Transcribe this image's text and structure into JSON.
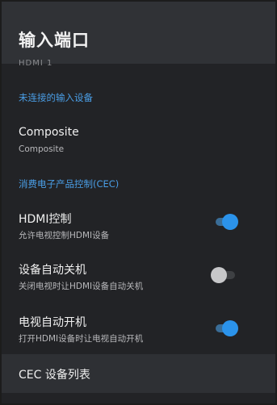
{
  "header": {
    "title": "输入端口"
  },
  "clipped_item": {
    "label": "HDMI 1"
  },
  "sections": {
    "unconnected": {
      "header": "未连接的输入设备"
    },
    "cec": {
      "header": "消费电子产品控制(CEC)"
    }
  },
  "items": {
    "composite": {
      "title": "Composite",
      "subtitle": "Composite"
    },
    "hdmi_control": {
      "title": "HDMI控制",
      "subtitle": "允许电视控制HDMI设备",
      "enabled": true
    },
    "device_auto_off": {
      "title": "设备自动关机",
      "subtitle": "关闭电视时让HDMI设备自动关机",
      "enabled": false
    },
    "tv_auto_on": {
      "title": "电视自动开机",
      "subtitle": "打开HDMI设备时让电视自动开机",
      "enabled": true
    },
    "cec_device_list": {
      "title": "CEC 设备列表"
    }
  },
  "colors": {
    "accent": "#2b93eb",
    "section_header": "#4a9ee6",
    "background": "#222326",
    "header_bg": "#303236",
    "focused_row_bg": "#2e3034"
  }
}
